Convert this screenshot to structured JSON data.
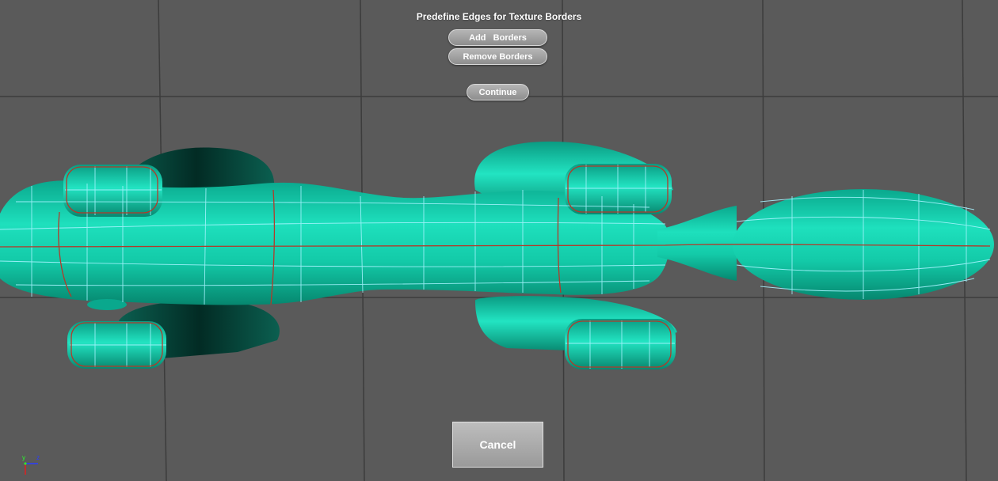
{
  "dialog": {
    "title": "Predefine Edges for Texture Borders",
    "add_label": "Add   Borders",
    "remove_label": "Remove Borders",
    "continue_label": "Continue",
    "cancel_label": "Cancel"
  },
  "gizmo": {
    "y_label": "y",
    "z_label": "z"
  },
  "colors": {
    "background": "#5a5a5a",
    "mesh": "#0fc9a8",
    "wireframe": "#9ff0ff",
    "border_edges": "#b23a2a",
    "grid": "#3c3c3c"
  }
}
